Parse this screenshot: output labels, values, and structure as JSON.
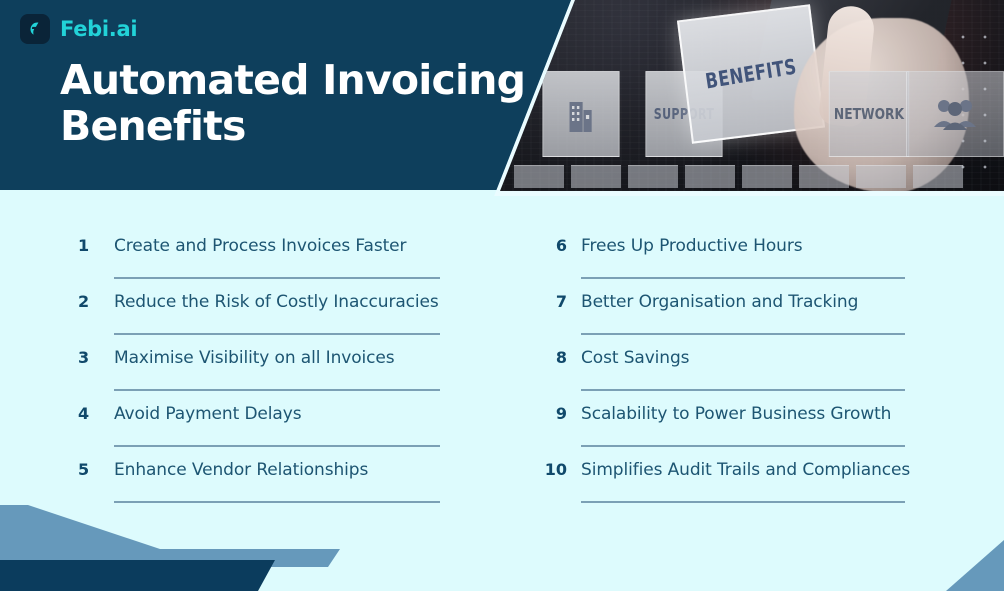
{
  "brand": {
    "name": "Febi.ai",
    "logo_icon": "febi-f-logo-icon",
    "logo_bg": "#0a2438",
    "logo_fg": "#22d3d8"
  },
  "header": {
    "title": "Automated Invoicing\nBenefits",
    "background": "#0e3f5c",
    "title_color": "#ffffff"
  },
  "photo": {
    "alt": "hand touching translucent benefits tile on dark technology background",
    "tiles": [
      {
        "label": "",
        "icon": "building-icon"
      },
      {
        "label": "SUPPORT",
        "icon": ""
      }
    ],
    "featured_tile": "BENEFITS",
    "network_tile": "NETWORK",
    "people_tile_icon": "people-group-icon"
  },
  "page": {
    "background": "#ddfbfd",
    "rule_color": "#7ba0b5",
    "number_color": "#10496b",
    "label_color": "#1d5572",
    "footer_blue": "#6699bb",
    "footer_navy": "#0b3c5d"
  },
  "benefits": {
    "left": [
      {
        "number": "1",
        "label": "Create and Process Invoices Faster"
      },
      {
        "number": "2",
        "label": "Reduce the Risk of Costly Inaccuracies"
      },
      {
        "number": "3",
        "label": "Maximise Visibility on all Invoices"
      },
      {
        "number": "4",
        "label": "Avoid Payment Delays"
      },
      {
        "number": "5",
        "label": "Enhance Vendor Relationships"
      }
    ],
    "right": [
      {
        "number": "6",
        "label": "Frees Up Productive Hours"
      },
      {
        "number": "7",
        "label": "Better Organisation and Tracking"
      },
      {
        "number": "8",
        "label": "Cost Savings"
      },
      {
        "number": "9",
        "label": "Scalability to Power Business Growth"
      },
      {
        "number": "10",
        "label": "Simplifies Audit Trails and Compliances"
      }
    ]
  }
}
